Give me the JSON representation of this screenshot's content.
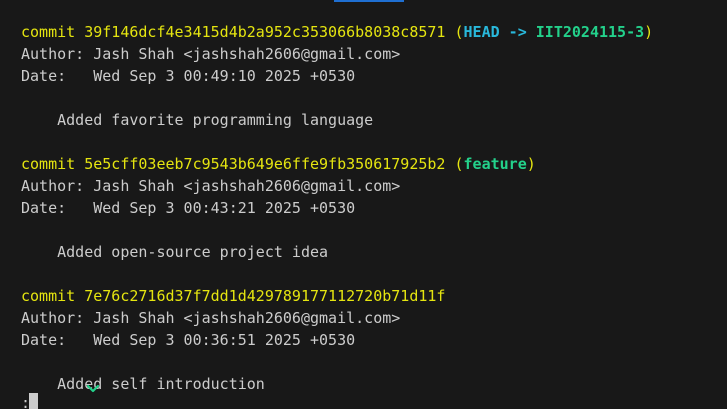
{
  "commits": [
    {
      "commit_keyword": "commit",
      "hash": "39f146dcf4e3415d4b2a952c353066b8038c8571",
      "refs_open": "(",
      "head_label": "HEAD -> ",
      "branch_label": "IIT2024115-3",
      "refs_close": ")",
      "author_line": "Author: Jash Shah <jashshah2606@gmail.com>",
      "date_line": "Date:   Wed Sep 3 00:49:10 2025 +0530",
      "message": "    Added favorite programming language"
    },
    {
      "commit_keyword": "commit",
      "hash": "5e5cff03eeb7c9543b649e6ffe9fb350617925b2",
      "refs_open": "(",
      "branch_label": "feature",
      "refs_close": ")",
      "author_line": "Author: Jash Shah <jashshah2606@gmail.com>",
      "date_line": "Date:   Wed Sep 3 00:43:21 2025 +0530",
      "message": "    Added open-source project idea"
    },
    {
      "commit_keyword": "commit",
      "hash": "7e76c2716d37f7dd1d429789177112720b71d11f",
      "author_line": "Author: Jash Shah <jashshah2606@gmail.com>",
      "date_line": "Date:   Wed Sep 3 00:36:51 2025 +0530",
      "message": "    Added self introduction"
    }
  ],
  "pager_prompt": ":",
  "colors": {
    "background": "#181818",
    "text": "#cccccc",
    "commit_hash": "#e5e510",
    "head_ref": "#29b8db",
    "branch_ref": "#23d18b",
    "tab_indicator": "#1f6fd1"
  },
  "icons": [
    "sparkle-icon"
  ]
}
